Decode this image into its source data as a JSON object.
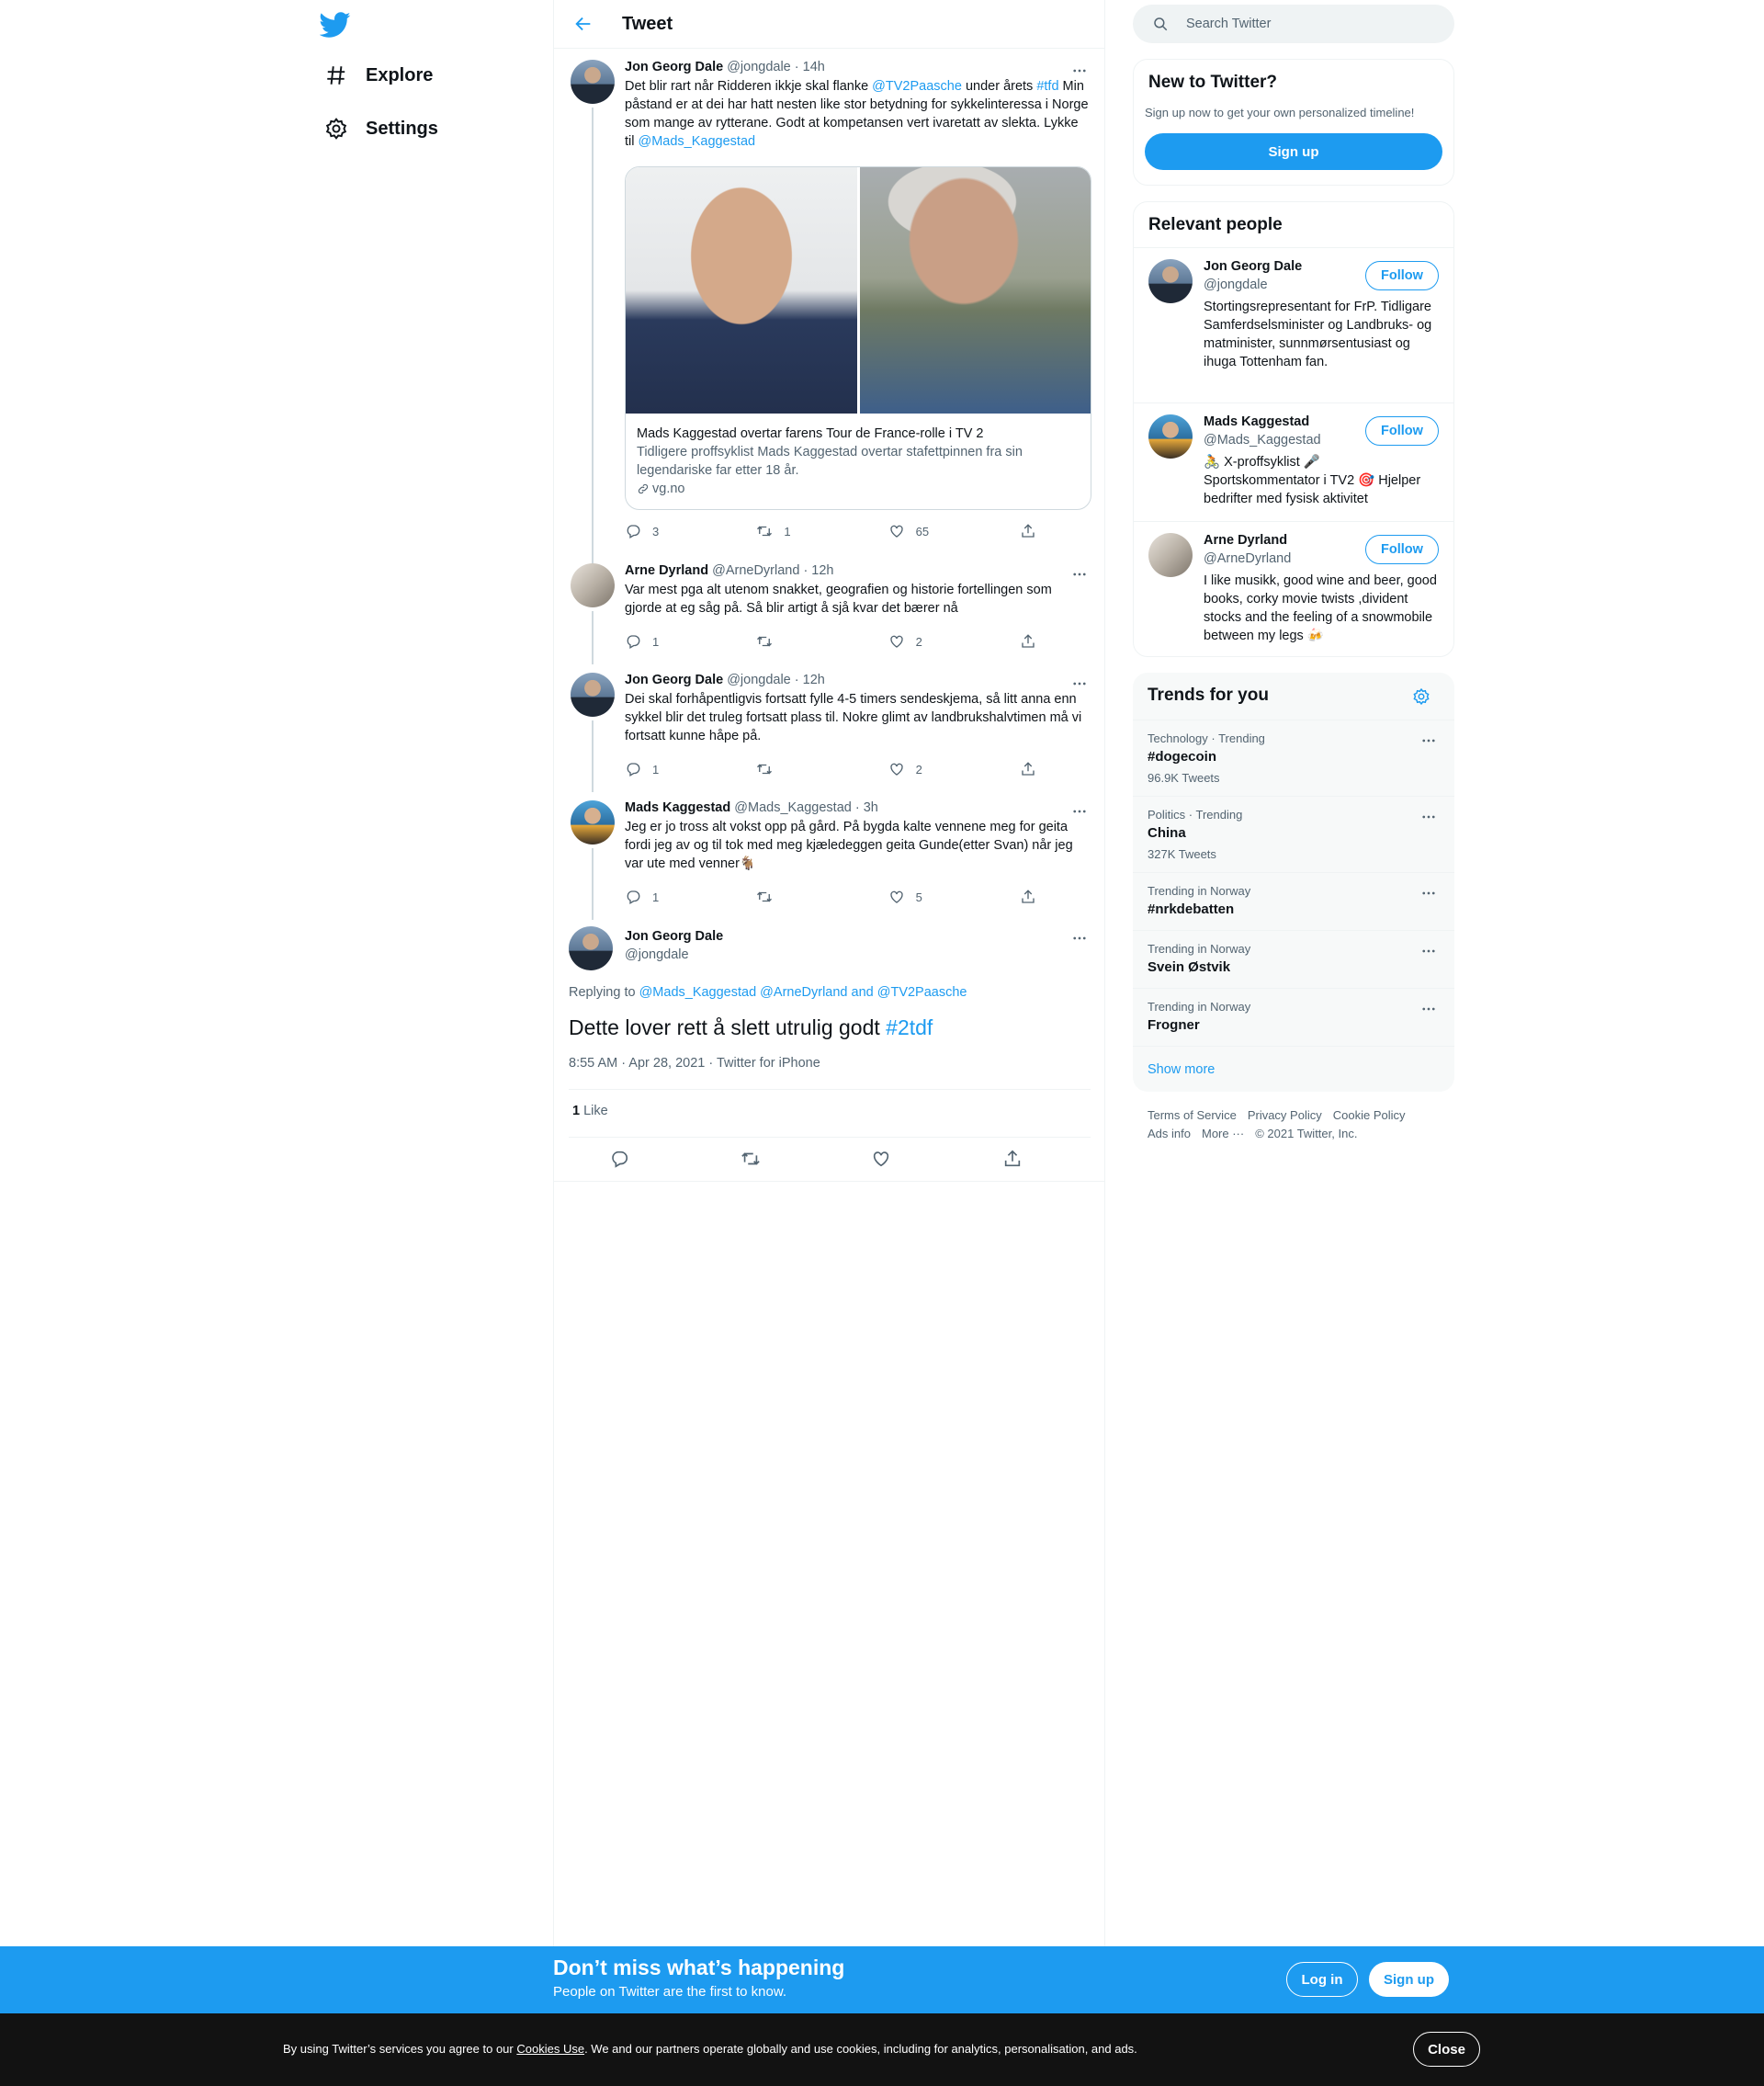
{
  "nav": {
    "explore": "Explore",
    "settings": "Settings"
  },
  "header": {
    "title": "Tweet"
  },
  "tweets": [
    {
      "name": "Jon Georg Dale",
      "handle": "@jongdale",
      "time": "· 14h",
      "text_parts": [
        "Det blir rart når Ridderen ikkje skal flanke ",
        "@TV2Paasche",
        " under årets ",
        "#tfd",
        " Min påstand er at dei har hatt nesten like stor betydning for sykkelinteressa i Norge som mange av rytterane. Godt at kompetansen vert ivaretatt av slekta. Lykke til ",
        "@Mads_Kaggestad"
      ],
      "card": {
        "title": "Mads Kaggestad overtar farens Tour de France-rolle i TV 2",
        "description": "Tidligere proffsyklist Mads Kaggestad overtar stafettpinnen fra sin legendariske far etter 18 år.",
        "domain": "vg.no"
      },
      "replies": "3",
      "retweets": "1",
      "likes": "65"
    },
    {
      "name": "Arne Dyrland",
      "handle": "@ArneDyrland",
      "time": "· 12h",
      "text": "Var mest pga alt utenom snakket, geografien og historie fortellingen som gjorde at eg såg på. Så blir artigt å sjå kvar det bærer nå",
      "replies": "1",
      "retweets": "",
      "likes": "2"
    },
    {
      "name": "Jon Georg Dale",
      "handle": "@jongdale",
      "time": "· 12h",
      "text": "Dei skal forhåpentligvis fortsatt fylle 4-5 timers sendeskjema, så litt anna enn sykkel blir det truleg fortsatt plass til. Nokre glimt av landbrukshalvtimen må vi fortsatt kunne håpe på.",
      "replies": "1",
      "retweets": "",
      "likes": "2"
    },
    {
      "name": "Mads Kaggestad",
      "handle": "@Mads_Kaggestad",
      "time": "· 3h",
      "text": "Jeg er jo tross alt vokst opp på gård. På bygda kalte vennene meg for geita fordi jeg av og til tok med meg kjæledeggen geita Gunde(etter Svan) når jeg var ute med venner🐐",
      "replies": "1",
      "retweets": "",
      "likes": "5"
    }
  ],
  "focus": {
    "name": "Jon Georg Dale",
    "handle": "@jongdale",
    "replying_prefix": "Replying to ",
    "replying_to": "@Mads_Kaggestad @ArneDyrland and @TV2Paasche",
    "text": "Dette lover rett å slett utrulig godt ",
    "hashtag": "#2tdf",
    "date": "8:55 AM · Apr 28, 2021 · Twitter for iPhone",
    "likes_count": "1",
    "likes_label": " Like"
  },
  "search": {
    "placeholder": "Search Twitter"
  },
  "new_to_twitter": {
    "title": "New to Twitter?",
    "subtitle": "Sign up now to get your own personalized timeline!",
    "button": "Sign up"
  },
  "relevant": {
    "title": "Relevant people",
    "follow_label": "Follow",
    "people": [
      {
        "name": "Jon Georg Dale",
        "handle": "@jongdale",
        "bio": "Stortingsrepresentant for FrP. Tidligare Samferdselsminister og Landbruks- og matminister, sunnmørsentusiast og ihuga Tottenham fan."
      },
      {
        "name": "Mads Kaggestad",
        "handle": "@Mads_Kaggestad",
        "bio": "🚴 X-proffsyklist 🎤 Sportskommentator i TV2 🎯 Hjelper bedrifter med fysisk aktivitet"
      },
      {
        "name": "Arne Dyrland",
        "handle": "@ArneDyrland",
        "bio": "I like musikk, good wine and beer, good books, corky movie twists ,divident stocks and the feeling of a snowmobile between my legs 🍻"
      }
    ]
  },
  "trends": {
    "title": "Trends for you",
    "items": [
      {
        "context": "Technology · Trending",
        "name": "#dogecoin",
        "count": "96.9K Tweets"
      },
      {
        "context": "Politics · Trending",
        "name": "China",
        "count": "327K Tweets"
      },
      {
        "context": "Trending in Norway",
        "name": "#nrkdebatten",
        "count": ""
      },
      {
        "context": "Trending in Norway",
        "name": "Svein Østvik",
        "count": ""
      },
      {
        "context": "Trending in Norway",
        "name": "Frogner",
        "count": ""
      }
    ],
    "show_more": "Show more"
  },
  "footer": {
    "terms": "Terms of Service",
    "privacy": "Privacy Policy",
    "cookie": "Cookie Policy",
    "ads": "Ads info",
    "more": "More ···",
    "copyright": "© 2021 Twitter, Inc."
  },
  "banner": {
    "title": "Don’t miss what’s happening",
    "subtitle": "People on Twitter are the first to know.",
    "login": "Log in",
    "signup": "Sign up"
  },
  "cookies": {
    "text_before": "By using Twitter’s services you agree to our ",
    "link": "Cookies Use",
    "text_after": ". We and our partners operate globally and use cookies, including for analytics, personalisation, and ads.",
    "close": "Close"
  },
  "colors": {
    "accent": "#1d9bf0",
    "text": "#0f1419",
    "muted": "#536471",
    "cookie_bg": "#121212"
  },
  "icons": [
    "twitter-logo-icon",
    "hashtag-icon",
    "gear-icon",
    "back-arrow-icon",
    "more-icon",
    "reply-icon",
    "retweet-icon",
    "like-icon",
    "share-icon",
    "link-icon",
    "search-icon"
  ]
}
